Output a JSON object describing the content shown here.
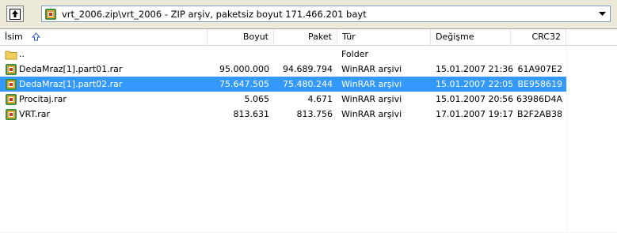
{
  "address": {
    "path_text": "vrt_2006.zip\\vrt_2006 - ZIP arşiv, paketsiz boyut 171.466.201 bayt"
  },
  "columns": {
    "name": "İsim",
    "size": "Boyut",
    "packed": "Paket",
    "type": "Tür",
    "modified": "Değişme",
    "crc": "CRC32"
  },
  "rows": [
    {
      "name": "..",
      "size": "",
      "packed": "",
      "type": "Folder",
      "modified": "",
      "crc": "",
      "icon": "folder-icon"
    },
    {
      "name": "DedaMraz[1].part01.rar",
      "size": "95.000.000",
      "packed": "94.689.794",
      "type": "WinRAR arşivi",
      "modified": "15.01.2007 21:36",
      "crc": "61A907E2",
      "icon": "rar-file-icon"
    },
    {
      "name": "DedaMraz[1].part02.rar",
      "size": "75.647.505",
      "packed": "75.480.244",
      "type": "WinRAR arşivi",
      "modified": "15.01.2007 22:05",
      "crc": "BE958619",
      "icon": "rar-file-icon",
      "selected": true
    },
    {
      "name": "Procitaj.rar",
      "size": "5.065",
      "packed": "4.671",
      "type": "WinRAR arşivi",
      "modified": "15.01.2007 20:56",
      "crc": "63986D4A",
      "icon": "rar-file-icon"
    },
    {
      "name": "VRT.rar",
      "size": "813.631",
      "packed": "813.756",
      "type": "WinRAR arşivi",
      "modified": "17.01.2007 19:17",
      "crc": "B2F2AB38",
      "icon": "rar-file-icon"
    }
  ],
  "colors": {
    "selection": "#3399ff",
    "toolbar_bg": "#ece9d8"
  }
}
